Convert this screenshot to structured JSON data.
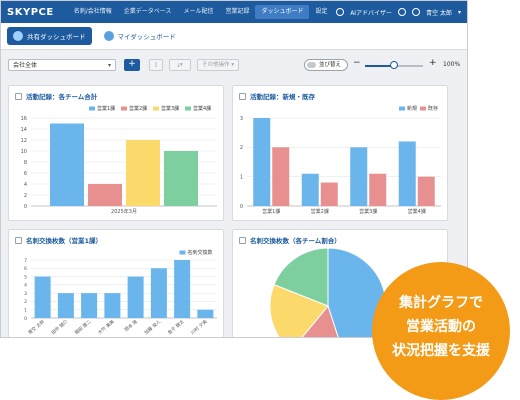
{
  "app": {
    "logo": "SKYPCE",
    "nav": [
      "名刺/会社情報",
      "企業データベース",
      "メール配信",
      "営業記録",
      "ダッシュボード",
      "設定"
    ],
    "nav_active_index": 4,
    "user": {
      "ai_label": "AIアドバイザー",
      "name": "青空 太郎"
    }
  },
  "tabs": {
    "shared": "共有ダッシュボード",
    "mine": "マイダッシュボード"
  },
  "toolbar": {
    "company_select": "会社全体",
    "add": "+",
    "other_ops": "その他操作",
    "toggle_label": "並び替え",
    "zoom_minus": "−",
    "zoom_plus": "+",
    "zoom_value": "100%",
    "zoom_level": 0.5
  },
  "panels": {
    "p1": {
      "title": "活動記録：各チーム合計",
      "chart_data": {
        "type": "bar",
        "categories": [
          "2025年3月"
        ],
        "series": [
          {
            "name": "営業1課",
            "values": [
              15
            ]
          },
          {
            "name": "営業2課",
            "values": [
              4
            ]
          },
          {
            "name": "営業3課",
            "values": [
              12
            ]
          },
          {
            "name": "営業4課",
            "values": [
              10
            ]
          }
        ],
        "ylim": [
          0,
          16
        ],
        "yticks": [
          0,
          2,
          4,
          6,
          8,
          10,
          12,
          14,
          16
        ]
      }
    },
    "p2": {
      "title": "活動記録：新規・既存",
      "chart_data": {
        "type": "bar",
        "categories": [
          "営業1課",
          "営業2課",
          "営業3課",
          "営業4課"
        ],
        "series": [
          {
            "name": "新規",
            "values": [
              3,
              1.1,
              2,
              2.2
            ]
          },
          {
            "name": "既存",
            "values": [
              2,
              0.8,
              1.1,
              1
            ]
          }
        ],
        "ylim": [
          0,
          3
        ],
        "yticks": [
          0,
          1,
          2,
          3
        ]
      }
    },
    "p3": {
      "title": "名刺交換枚数（営業1課）",
      "chart_data": {
        "type": "bar",
        "categories": [
          "青空 太郎",
          "田中 健介",
          "堀田 康二",
          "大竹 美美",
          "岡本 隆",
          "加藤 俊人",
          "金子 健太",
          "川村 夕実"
        ],
        "series": [
          {
            "name": "名刺交換数",
            "values": [
              5,
              3,
              3,
              3,
              5,
              6,
              7,
              1
            ]
          }
        ],
        "ylim": [
          0,
          7
        ],
        "yticks": [
          0,
          1,
          2,
          3,
          4,
          5,
          6,
          7
        ]
      }
    },
    "p4": {
      "title": "名刺交換枚数（各チーム割合）",
      "chart_data": {
        "type": "pie",
        "slices": [
          {
            "value": 45
          },
          {
            "value": 16
          },
          {
            "value": 20
          },
          {
            "value": 19
          }
        ]
      }
    }
  },
  "colors": {
    "blue": "#6ab6ec",
    "red": "#e88f8f",
    "yellow": "#fbd96b",
    "green": "#7ecf9f",
    "brand": "#1d5b9e",
    "badge": "#f39a16"
  },
  "badge": {
    "lines": [
      "集計グラフで",
      "営業活動の",
      "状況把握を支援"
    ]
  }
}
